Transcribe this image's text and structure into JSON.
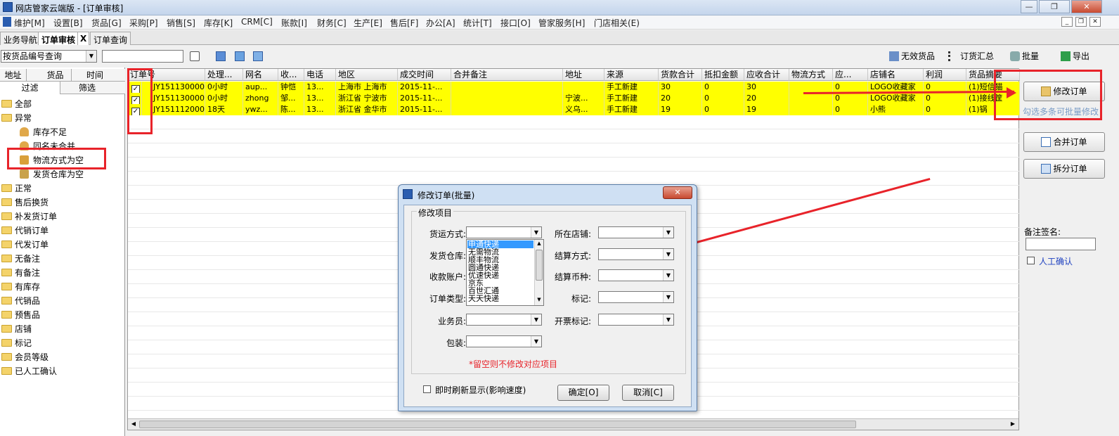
{
  "window": {
    "title": "网店管家云端版 - [订单审核]"
  },
  "menu": [
    "维护[M]",
    "设置[B]",
    "货品[G]",
    "采购[P]",
    "销售[S]",
    "库存[K]",
    "CRM[C]",
    "账款[I]",
    "财务[C]",
    "生产[E]",
    "售后[F]",
    "办公[A]",
    "统计[T]",
    "接口[O]",
    "管家服务[H]",
    "门店相关(E)"
  ],
  "tabs": [
    {
      "label": "业务导航"
    },
    {
      "label": "订单审核"
    },
    {
      "label": "X"
    },
    {
      "label": "订单查询"
    }
  ],
  "toolbar": {
    "query_mode": "按货品编号查询",
    "search_value": "",
    "invalid_goods": "无效货品",
    "order_summary": "订货汇总",
    "batch": "批量",
    "export": "导出"
  },
  "left_panel": {
    "tabs_row1": [
      "地址",
      "货品",
      "时间"
    ],
    "tabs_row2": [
      "过滤",
      "筛选"
    ],
    "tree": {
      "all": "全部",
      "abnormal": "异常",
      "stock_short": "库存不足",
      "same_name": "同名未合并",
      "no_logistics": "物流方式为空",
      "no_warehouse": "发货仓库为空",
      "normal": "正常",
      "after_sale": "售后换货",
      "resend": "补发货订单",
      "consign": "代销订单",
      "drop_ship": "代发订单",
      "no_remark": "无备注",
      "has_remark": "有备注",
      "in_stock": "有库存",
      "consign_goods": "代销品",
      "presale": "预售品",
      "store": "店铺",
      "mark": "标记",
      "member_level": "会员等级",
      "manual_confirmed": "已人工确认"
    }
  },
  "grid": {
    "columns": [
      "订单号",
      "处理...",
      "网名",
      "收...",
      "电话",
      "地区",
      "成交时间",
      "合并备注",
      "地址",
      "来源",
      "货款合计",
      "抵扣金额",
      "应收合计",
      "物流方式",
      "应...",
      "店铺名",
      "利润",
      "货品摘要"
    ],
    "rows": [
      [
        "✓",
        "JY1511300005",
        "0小时",
        "aup...",
        "钟恺",
        "13...",
        "上海市 上海市",
        "2015-11-...",
        "",
        "",
        "手工新建",
        "30",
        "0",
        "30",
        "",
        "0",
        "LOGO收藏家",
        "0",
        "(1)短信猫"
      ],
      [
        "✓",
        "JY1511300004",
        "0小时",
        "zhong",
        "邹...",
        "13...",
        "浙江省 宁波市",
        "2015-11-...",
        "",
        "宁波...",
        "手工新建",
        "20",
        "0",
        "20",
        "",
        "0",
        "LOGO收藏家",
        "0",
        "(1)接线筐"
      ],
      [
        "✓",
        "JY1511120001",
        "18天",
        "ywz...",
        "陈...",
        "13...",
        "浙江省 金华市",
        "2015-11-...",
        "",
        "义乌...",
        "手工新建",
        "19",
        "0",
        "19",
        "",
        "0",
        "小熊",
        "0",
        "(1)锅"
      ]
    ]
  },
  "right_panel": {
    "modify_order": "修改订单",
    "hint": "勾选多条可批量修改",
    "merge_order": "合并订单",
    "split_order": "拆分订单",
    "remark_sign_label": "备注签名:",
    "remark_sign_value": "",
    "manual_confirm": "人工确认"
  },
  "dialog": {
    "title": "修改订单(批量)",
    "group_title": "修改项目",
    "shipping_method_label": "货运方式:",
    "warehouse_label": "发货仓库:",
    "account_label": "收款账户:",
    "order_type_label": "订单类型:",
    "salesman_label": "业务员:",
    "packing_label": "包装:",
    "store_label": "所在店铺:",
    "settle_label": "结算方式:",
    "currency_label": "结算币种:",
    "mark_label": "标记:",
    "invoice_label": "开票标记:",
    "note": "*留空则不修改对应项目",
    "refresh_label": "即时刷新显示(影响速度)",
    "ok": "确定[O]",
    "cancel": "取消[C]",
    "shipping_options": [
      "申通快递",
      "无需物流",
      "顺丰物流",
      "圆通快递",
      "优速快递",
      "京东",
      "百世汇通",
      "天天快递"
    ]
  }
}
